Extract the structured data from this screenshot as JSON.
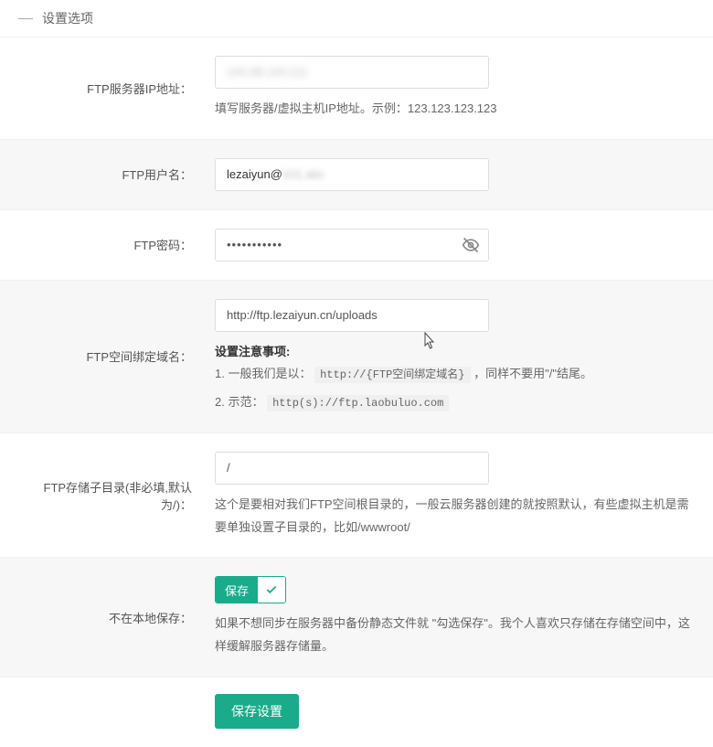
{
  "section_title": "设置选项",
  "rows": {
    "ip": {
      "label": "FTP服务器IP地址：",
      "value": "144.48.143.111",
      "help": "填写服务器/虚拟主机IP地址。示例：123.123.123.123"
    },
    "user": {
      "label": "FTP用户名：",
      "value_prefix": "lezaiyun@",
      "value_blur": "101.abc"
    },
    "pass": {
      "label": "FTP密码：",
      "value": "•••••••••••"
    },
    "domain": {
      "label": "FTP空间绑定域名：",
      "value": "http://ftp.lezaiyun.cn/uploads",
      "notice_title": "设置注意事项:",
      "line1_a": "1. 一般我们是以：",
      "line1_code": "http://{FTP空间绑定域名}",
      "line1_b": "，同样不要用\"/\"结尾。",
      "line2_a": "2. 示范：",
      "line2_code": "http(s)://ftp.laobuluo.com"
    },
    "subdir": {
      "label": "FTP存储子目录(非必填,默认为/)：",
      "value": "/",
      "help": "这个是要相对我们FTP空间根目录的，一般云服务器创建的就按照默认，有些虚拟主机是需要单独设置子目录的，比如/wwwroot/"
    },
    "local": {
      "label": "不在本地保存：",
      "toggle_text": "保存",
      "help": "如果不想同步在服务器中备份静态文件就 \"勾选保存\"。我个人喜欢只存储在存储空间中，这样缓解服务器存储量。"
    },
    "submit": {
      "button": "保存设置"
    }
  }
}
